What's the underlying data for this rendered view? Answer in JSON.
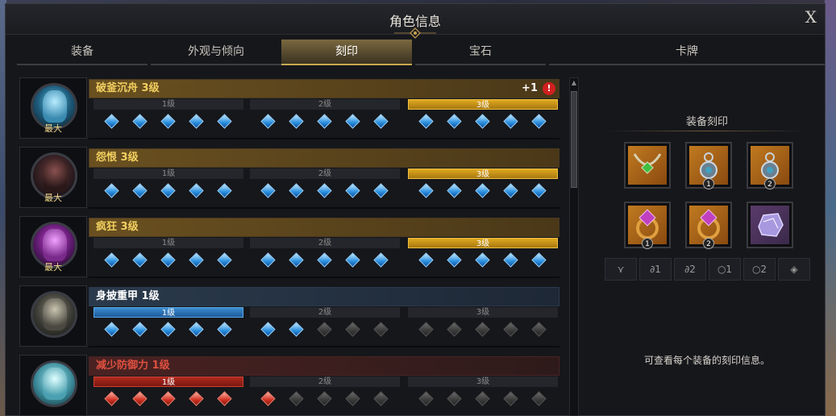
{
  "window": {
    "title": "角色信息",
    "close_label": "X"
  },
  "tabs": [
    {
      "label": "装备"
    },
    {
      "label": "外观与倾向"
    },
    {
      "label": "刻印"
    },
    {
      "label": "宝石"
    },
    {
      "label": "卡牌"
    }
  ],
  "active_tab": "刻印",
  "engravings": [
    {
      "name": "破釜沉舟 3级",
      "max_label": "最大",
      "levels": [
        "1级",
        "2级",
        "3级"
      ],
      "active_level": "3级",
      "bonus": "+1",
      "warning": "!",
      "style": "gold"
    },
    {
      "name": "怨恨 3级",
      "max_label": "最大",
      "levels": [
        "1级",
        "2级",
        "3级"
      ],
      "active_level": "3级",
      "style": "gold"
    },
    {
      "name": "疯狂 3级",
      "max_label": "最大",
      "levels": [
        "1级",
        "2级",
        "3级"
      ],
      "active_level": "3级",
      "style": "gold"
    },
    {
      "name": "身披重甲 1级",
      "levels": [
        "1级",
        "2级",
        "3级"
      ],
      "active_level": "1级",
      "style": "blue"
    },
    {
      "name": "减少防御力 1级",
      "levels": [
        "1级",
        "2级",
        "3级"
      ],
      "active_level": "1级",
      "style": "red"
    }
  ],
  "side": {
    "title": "装备刻印",
    "slots": [
      {
        "icon": "necklace-icon",
        "badge": ""
      },
      {
        "icon": "earring-icon",
        "badge": "1"
      },
      {
        "icon": "earring-icon",
        "badge": "2"
      },
      {
        "icon": "ring-icon",
        "badge": "1"
      },
      {
        "icon": "ring-icon",
        "badge": "2"
      },
      {
        "icon": "stone-icon",
        "badge": ""
      }
    ],
    "filters": [
      "necklace-filter-icon",
      "earring-1-filter-icon",
      "earring-2-filter-icon",
      "ring-1-filter-icon",
      "ring-2-filter-icon",
      "stone-filter-icon"
    ],
    "filter_labels": [
      "",
      "1",
      "2",
      "1",
      "2",
      ""
    ],
    "info": "可查看每个装备的刻印信息。"
  },
  "colors": {
    "gold": "#f2d060",
    "blue_level": "#3a8cd0",
    "red_level": "#b02a20",
    "red_text": "#e05040"
  }
}
